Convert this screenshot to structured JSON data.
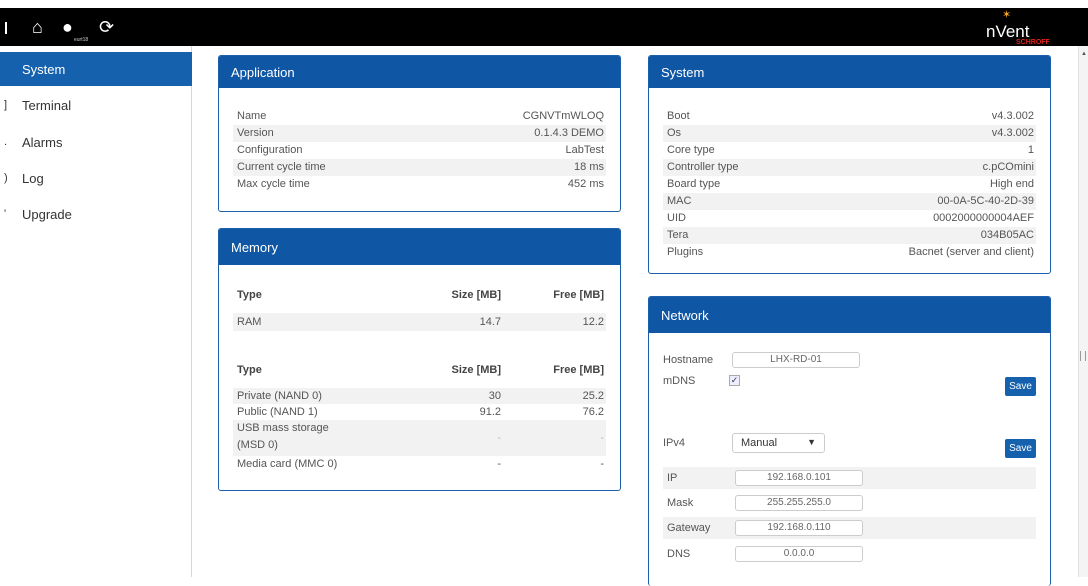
{
  "topbar": {
    "user_label": "eurt18"
  },
  "logo": {
    "brand": "nVent",
    "sub": "SCHROFF"
  },
  "sidebar": {
    "items": [
      {
        "label": "System"
      },
      {
        "label": "Terminal"
      },
      {
        "label": "Alarms"
      },
      {
        "label": "Log"
      },
      {
        "label": "Upgrade"
      }
    ]
  },
  "application": {
    "title": "Application",
    "rows": [
      {
        "k": "Name",
        "v": "CGNVTmWLOQ"
      },
      {
        "k": "Version",
        "v": "0.1.4.3 DEMO"
      },
      {
        "k": "Configuration",
        "v": "LabTest"
      },
      {
        "k": "Current cycle time",
        "v": "18 ms"
      },
      {
        "k": "Max cycle time",
        "v": "452 ms"
      }
    ]
  },
  "memory": {
    "title": "Memory",
    "t1": {
      "h1": "Type",
      "h2": "Size [MB]",
      "h3": "Free [MB]",
      "rows": [
        {
          "type": "RAM",
          "size": "14.7",
          "free": "12.2"
        }
      ]
    },
    "t2": {
      "h1": "Type",
      "h2": "Size [MB]",
      "h3": "Free [MB]",
      "rows": [
        {
          "type": "Private (NAND 0)",
          "size": "30",
          "free": "25.2"
        },
        {
          "type": "Public (NAND 1)",
          "size": "91.2",
          "free": "76.2"
        },
        {
          "type": "USB mass storage",
          "type2": "(MSD 0)",
          "size": "-",
          "free": "-"
        },
        {
          "type": "Media card (MMC 0)",
          "size": "-",
          "free": "-"
        }
      ]
    }
  },
  "system": {
    "title": "System",
    "rows": [
      {
        "k": "Boot",
        "v": "v4.3.002"
      },
      {
        "k": "Os",
        "v": "v4.3.002"
      },
      {
        "k": "Core type",
        "v": "1"
      },
      {
        "k": "Controller type",
        "v": "c.pCOmini"
      },
      {
        "k": "Board type",
        "v": "High end"
      },
      {
        "k": "MAC",
        "v": "00-0A-5C-40-2D-39"
      },
      {
        "k": "UID",
        "v": "0002000000004AEF"
      },
      {
        "k": "Tera",
        "v": "034B05AC"
      },
      {
        "k": "Plugins",
        "v": "Bacnet (server and client)"
      }
    ]
  },
  "network": {
    "title": "Network",
    "hostname_label": "Hostname",
    "hostname_value": "LHX-RD-01",
    "mdns_label": "mDNS",
    "mdns_check": "✓",
    "save_label": "Save",
    "ipv4_label": "IPv4",
    "ipv4_mode": "Manual",
    "ip_label": "IP",
    "ip_value": "192.168.0.101",
    "mask_label": "Mask",
    "mask_value": "255.255.255.0",
    "gateway_label": "Gateway",
    "gateway_value": "192.168.0.110",
    "dns_label": "DNS",
    "dns_value": "0.0.0.0"
  },
  "colors": {
    "accent": "#0f56a5",
    "topbar": "#000000"
  }
}
